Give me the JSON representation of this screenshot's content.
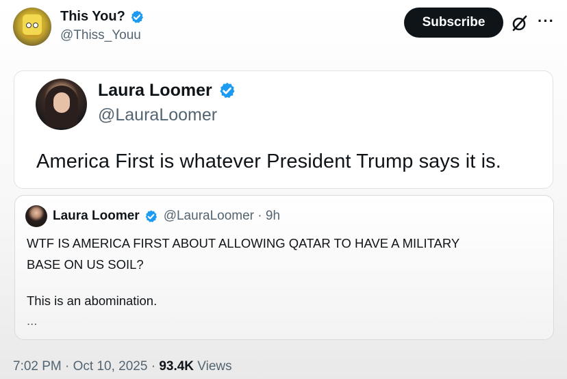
{
  "post": {
    "author_name": "This You?",
    "author_handle": "@Thiss_Youu",
    "subscribe_label": "Subscribe",
    "more_label": "···",
    "timestamp": "7:02 PM · Oct 10, 2025 · ",
    "views_count": "93.4K",
    "views_label": " Views"
  },
  "quoted": {
    "name": "Laura Loomer",
    "handle": "@LauraLoomer",
    "text": "America First is whatever President Trump says it is."
  },
  "nested_quote": {
    "name": "Laura Loomer",
    "handle_time": "@LauraLoomer · 9h",
    "line1": "WTF IS AMERICA FIRST ABOUT ALLOWING QATAR TO HAVE A MILITARY",
    "line2": "BASE ON US SOIL?",
    "line3": "This is an abomination.",
    "line4": "..."
  },
  "icons": {
    "verified": "verified-badge-icon",
    "grok": "grok-icon",
    "more": "more-icon"
  },
  "colors": {
    "verified_blue": "#1d9bf0",
    "text_primary": "#0f1419",
    "text_secondary": "#536471",
    "button_bg": "#0f1419"
  }
}
